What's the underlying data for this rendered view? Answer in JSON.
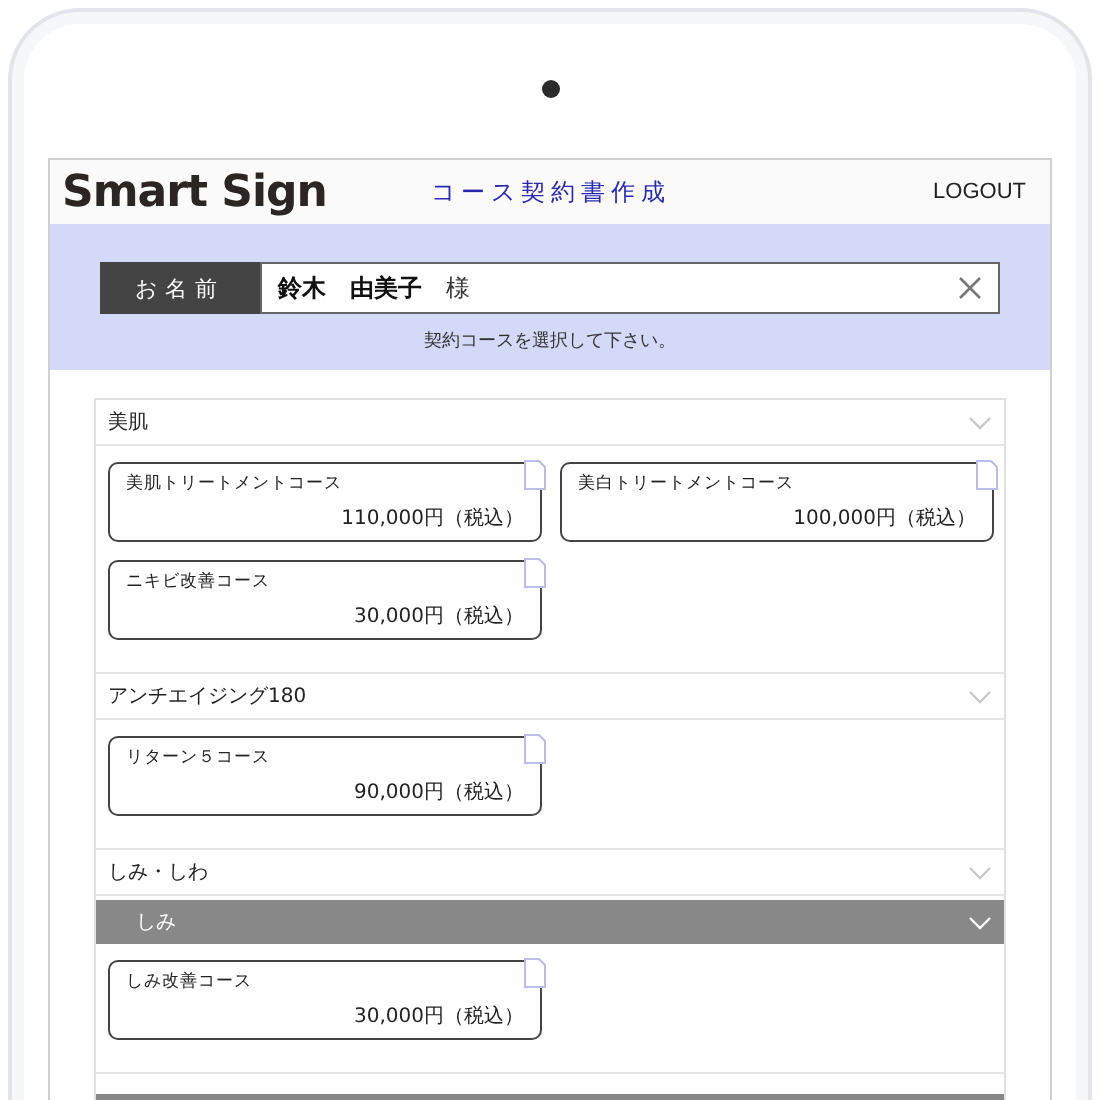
{
  "header": {
    "logo": "Smart Sign",
    "title": "コース契約書作成",
    "logout": "LOGOUT"
  },
  "customer": {
    "label": "お名前",
    "name": "鈴木　由美子",
    "honorific": "様",
    "instruction": "契約コースを選択して下さい。"
  },
  "categories": [
    {
      "title": "美肌",
      "courses": [
        {
          "name": "美肌トリートメントコース",
          "price": "110,000円（税込）"
        },
        {
          "name": "美白トリートメントコース",
          "price": "100,000円（税込）"
        },
        {
          "name": "ニキビ改善コース",
          "price": "30,000円（税込）"
        }
      ]
    },
    {
      "title": "アンチエイジング180",
      "courses": [
        {
          "name": "リターン５コース",
          "price": "90,000円（税込）"
        }
      ]
    },
    {
      "title": "しみ・しわ",
      "subcategories": [
        {
          "title": "しみ",
          "courses": [
            {
              "name": "しみ改善コース",
              "price": "30,000円（税込）"
            }
          ]
        }
      ]
    }
  ]
}
